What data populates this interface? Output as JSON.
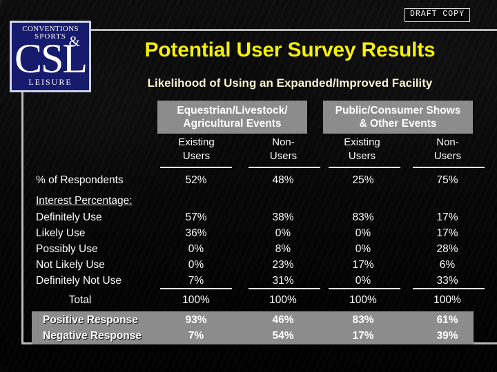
{
  "badge": {
    "label": "DRAFT  COPY"
  },
  "logo": {
    "line1": "CONVENTIONS",
    "line2": "SPORTS",
    "ampersand": "&",
    "monogram": "CSL",
    "line3": "LEISURE"
  },
  "header": {
    "title": "Potential User Survey Results",
    "subtitle": "Likelihood of Using an Expanded/Improved Facility"
  },
  "table": {
    "group_headers": [
      {
        "label": "Equestrian/Livestock/\nAgricultural Events",
        "line1": "Equestrian/Livestock/",
        "line2": "Agricultural Events"
      },
      {
        "label": "Public/Consumer Shows\n& Other Events",
        "line1": "Public/Consumer Shows",
        "line2": "& Other Events"
      }
    ],
    "column_headers": [
      {
        "line1": "Existing",
        "line2": "Users"
      },
      {
        "line1": "Non-",
        "line2": "Users"
      },
      {
        "line1": "Existing",
        "line2": "Users"
      },
      {
        "line1": "Non-",
        "line2": "Users"
      }
    ],
    "rows": {
      "respondents": {
        "label": "% of Respondents",
        "values": [
          "52%",
          "48%",
          "25%",
          "75%"
        ]
      },
      "interest_heading": {
        "label": "Interest Percentage:"
      },
      "definitely_use": {
        "label": "Definitely Use",
        "values": [
          "57%",
          "38%",
          "83%",
          "17%"
        ]
      },
      "likely_use": {
        "label": "Likely Use",
        "values": [
          "36%",
          "0%",
          "0%",
          "17%"
        ]
      },
      "possibly_use": {
        "label": "Possibly Use",
        "values": [
          "0%",
          "8%",
          "0%",
          "28%"
        ]
      },
      "not_likely_use": {
        "label": "Not Likely Use",
        "values": [
          "0%",
          "23%",
          "17%",
          "6%"
        ]
      },
      "definitely_not_use": {
        "label": "Definitely Not Use",
        "values": [
          "7%",
          "31%",
          "0%",
          "33%"
        ]
      },
      "total": {
        "label": "Total",
        "values": [
          "100%",
          "100%",
          "100%",
          "100%"
        ]
      },
      "positive_response": {
        "label": "Positive Response",
        "values": [
          "93%",
          "46%",
          "83%",
          "61%"
        ]
      },
      "negative_response": {
        "label": "Negative Response",
        "values": [
          "7%",
          "54%",
          "17%",
          "39%"
        ]
      }
    }
  },
  "colors": {
    "title": "#f7f200",
    "subtitle": "#fcf8d2",
    "header_band": "#8c8c8c",
    "logo_blue": "#161b6e",
    "rule": "#b9b9b9",
    "text": "#ffffff"
  }
}
